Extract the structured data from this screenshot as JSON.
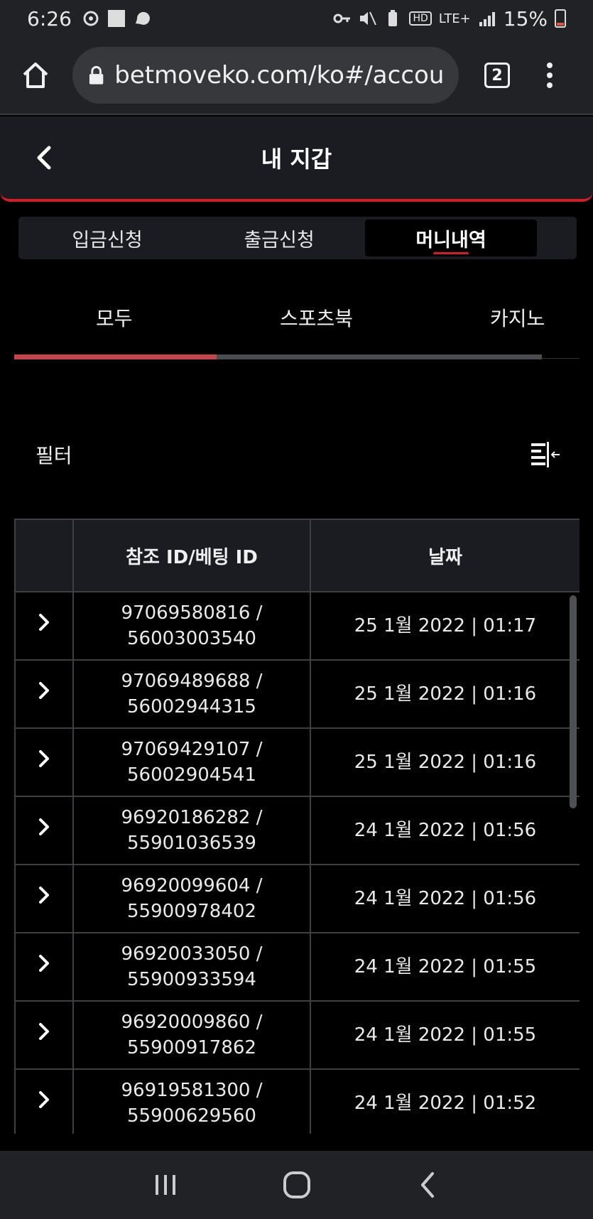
{
  "status_bar": {
    "time": "6:26",
    "battery": "15%",
    "network": "LTE+",
    "hd": "HD"
  },
  "browser": {
    "url": "betmoveko.com/ko#/accour",
    "tab_count": "2"
  },
  "header": {
    "title": "내 지갑"
  },
  "wallet_tabs": [
    {
      "label": "입금신청",
      "active": false
    },
    {
      "label": "출금신청",
      "active": false
    },
    {
      "label": "머니내역",
      "active": true
    }
  ],
  "category_tabs": [
    {
      "label": "모두",
      "active": true
    },
    {
      "label": "스포츠북",
      "active": false
    },
    {
      "label": "카지노",
      "active": false
    }
  ],
  "filter": {
    "label": "필터"
  },
  "table": {
    "headers": [
      "",
      "참조 ID/베팅 ID",
      "날짜"
    ],
    "rows": [
      {
        "ref_id": "97069580816 /",
        "bet_id": "56003003540",
        "date": "25 1월 2022 | 01:17"
      },
      {
        "ref_id": "97069489688 /",
        "bet_id": "56002944315",
        "date": "25 1월 2022 | 01:16"
      },
      {
        "ref_id": "97069429107 /",
        "bet_id": "56002904541",
        "date": "25 1월 2022 | 01:16"
      },
      {
        "ref_id": "96920186282 /",
        "bet_id": "55901036539",
        "date": "24 1월 2022 | 01:56"
      },
      {
        "ref_id": "96920099604 /",
        "bet_id": "55900978402",
        "date": "24 1월 2022 | 01:56"
      },
      {
        "ref_id": "96920033050 /",
        "bet_id": "55900933594",
        "date": "24 1월 2022 | 01:55"
      },
      {
        "ref_id": "96920009860 /",
        "bet_id": "55900917862",
        "date": "24 1월 2022 | 01:55"
      },
      {
        "ref_id": "96919581300 /",
        "bet_id": "55900629560",
        "date": "24 1월 2022 | 01:52"
      }
    ]
  },
  "colors": {
    "accent": "#d41d25",
    "background": "#000000",
    "panel": "#1b1c21"
  }
}
